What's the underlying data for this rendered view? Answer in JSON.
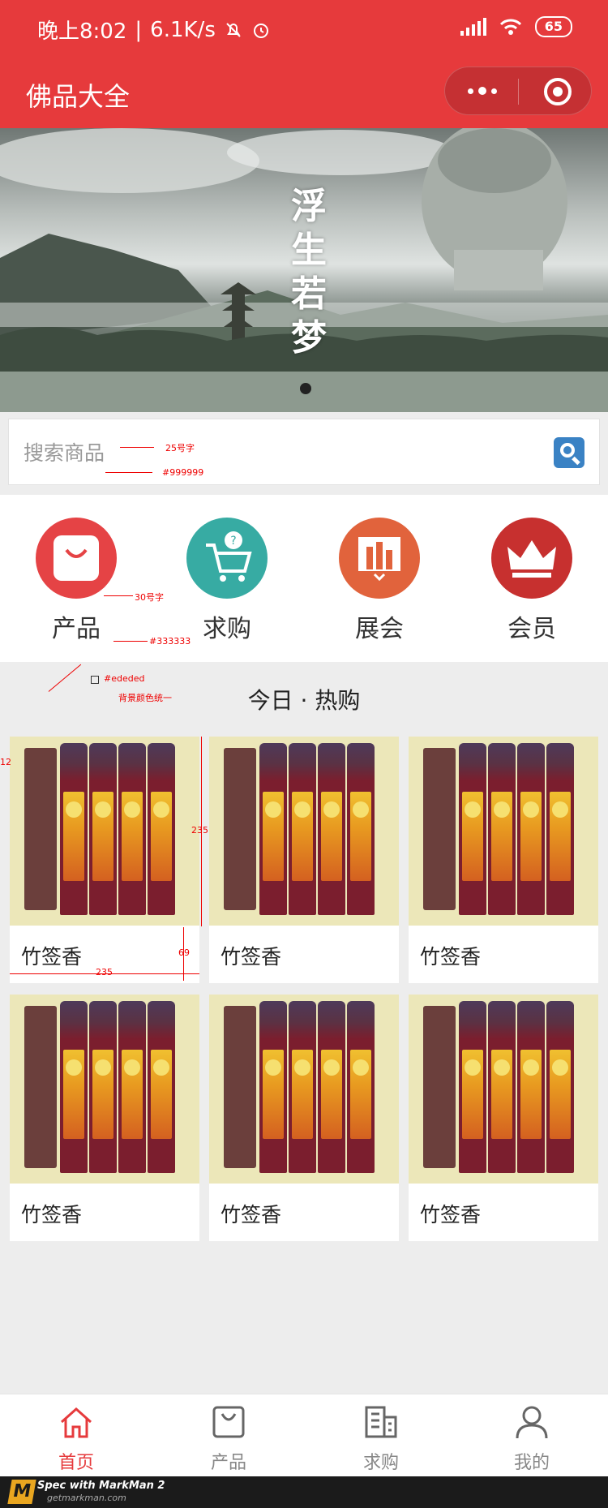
{
  "status_bar": {
    "time": "晚上8:02",
    "network_speed": "6.1K/s",
    "battery": "65"
  },
  "nav": {
    "title": "佛品大全"
  },
  "banner": {
    "text": "浮生若梦"
  },
  "search": {
    "placeholder": "搜索商品"
  },
  "categories": [
    {
      "label": "产品",
      "color": "#e54345"
    },
    {
      "label": "求购",
      "color": "#37aba3"
    },
    {
      "label": "展会",
      "color": "#e1633c"
    },
    {
      "label": "会员",
      "color": "#c7302f"
    }
  ],
  "annotations": {
    "search_font": "25号字",
    "search_color": "#999999",
    "cat_font": "30号字",
    "cat_color": "#333333",
    "bg_color": "#ededed",
    "bg_note": "背景颜色统一",
    "margin": "12",
    "img_height": "235",
    "name_height": "69",
    "card_width": "235"
  },
  "section": {
    "title": "今日 · 热购"
  },
  "products": [
    {
      "name": "竹签香"
    },
    {
      "name": "竹签香"
    },
    {
      "name": "竹签香"
    },
    {
      "name": "竹签香"
    },
    {
      "name": "竹签香"
    },
    {
      "name": "竹签香"
    }
  ],
  "tabs": [
    {
      "label": "首页",
      "icon": "home-icon",
      "active": true
    },
    {
      "label": "产品",
      "icon": "bag-icon",
      "active": false
    },
    {
      "label": "求购",
      "icon": "building-icon",
      "active": false
    },
    {
      "label": "我的",
      "icon": "user-icon",
      "active": false
    }
  ],
  "footer": {
    "line1": "Spec with MarkMan 2",
    "line2": "getmarkman.com",
    "logo": "M"
  },
  "colors": {
    "brand_red": "#e63a3c",
    "background": "#ededed",
    "search_blue": "#3a82c4"
  }
}
